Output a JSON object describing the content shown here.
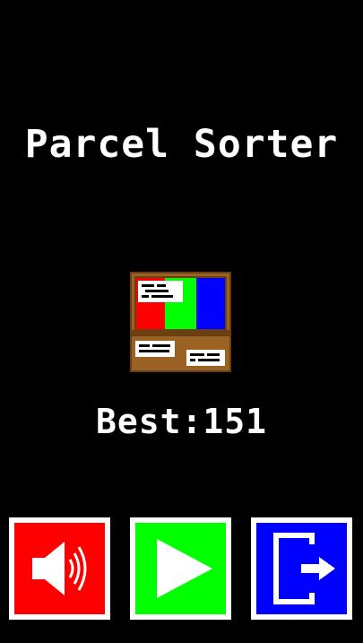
{
  "game": {
    "title": "Parcel Sorter",
    "best_label": "Best",
    "best_separator": ":",
    "best_score": "151"
  },
  "buttons": [
    {
      "name": "sound",
      "icon": "speaker-icon",
      "color": "#ff0000"
    },
    {
      "name": "play",
      "icon": "play-icon",
      "color": "#00ff00"
    },
    {
      "name": "exit",
      "icon": "exit-icon",
      "color": "#0000ff"
    }
  ],
  "logo": {
    "icon": "sorting-crate-icon",
    "colors": {
      "frame": "#9a6324",
      "bins": [
        "#ff0000",
        "#00ff00",
        "#0000ff"
      ],
      "label": "#ffffff"
    }
  }
}
